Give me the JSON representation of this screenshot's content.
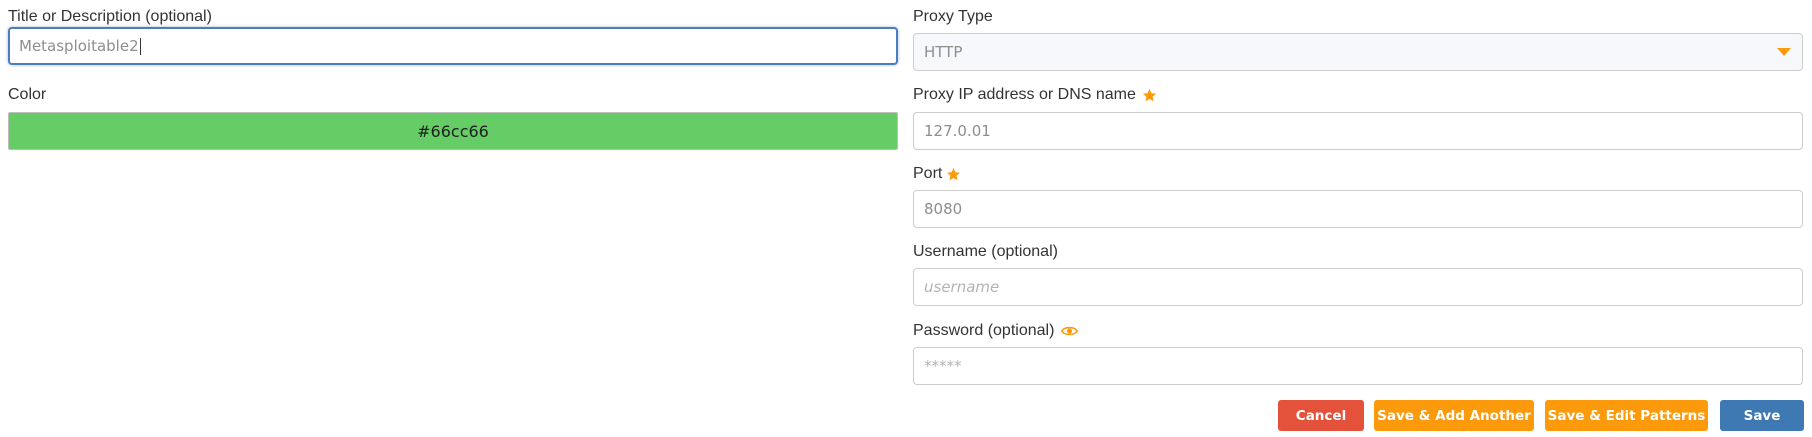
{
  "left": {
    "title_field": {
      "label": "Title or Description (optional)",
      "value": "Metasploitable2"
    },
    "color_field": {
      "label": "Color",
      "value": "#66cc66"
    }
  },
  "right": {
    "proxy_type": {
      "label": "Proxy Type",
      "selected": "HTTP"
    },
    "proxy_address": {
      "label": "Proxy IP address or DNS name",
      "value": "127.0.01"
    },
    "port": {
      "label": "Port",
      "value": "8080"
    },
    "username": {
      "label": "Username (optional)",
      "placeholder": "username"
    },
    "password": {
      "label": "Password (optional)",
      "placeholder": "*****"
    }
  },
  "buttons": {
    "cancel": "Cancel",
    "save_add_another": "Save & Add Another",
    "save_edit_patterns": "Save & Edit Patterns",
    "save": "Save"
  },
  "colors": {
    "swatch": "#66cc66",
    "accent_orange": "#fd9a0b",
    "cancel_red": "#e4523b",
    "save_blue": "#3f79b4",
    "focus_border": "#4a7ec0"
  },
  "icons": {
    "required": "star-icon",
    "dropdown": "caret-down-icon",
    "show_password": "eye-icon"
  }
}
